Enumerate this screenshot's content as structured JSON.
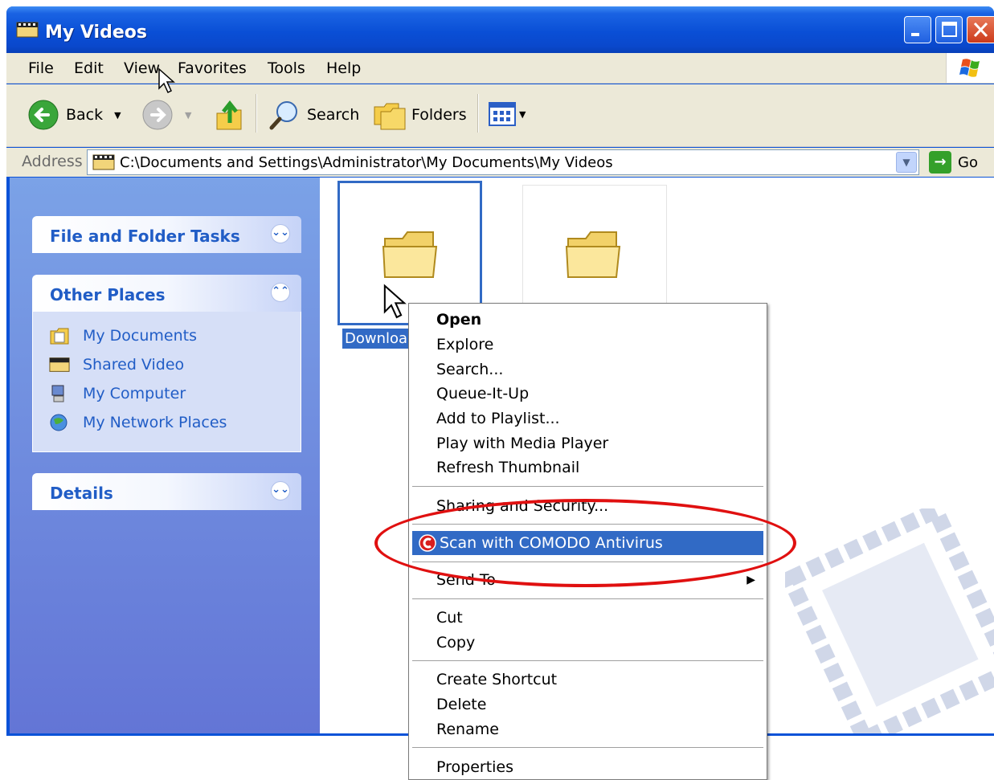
{
  "window": {
    "title": "My Videos"
  },
  "menubar": {
    "items": [
      "File",
      "Edit",
      "View",
      "Favorites",
      "Tools",
      "Help"
    ]
  },
  "toolbar": {
    "back_label": "Back",
    "search_label": "Search",
    "folders_label": "Folders"
  },
  "address": {
    "label": "Address",
    "path": "C:\\Documents and Settings\\Administrator\\My Documents\\My Videos",
    "go_label": "Go"
  },
  "leftpane": {
    "file_tasks": "File and Folder Tasks",
    "other_places": "Other Places",
    "places": [
      "My Documents",
      "Shared Video",
      "My Computer",
      "My Network Places"
    ],
    "details": "Details"
  },
  "content": {
    "selected_folder_label": "Downloac"
  },
  "context_menu": {
    "open": "Open",
    "explore": "Explore",
    "search": "Search...",
    "queue": "Queue-It-Up",
    "add_playlist": "Add to Playlist...",
    "play_media": "Play with Media Player",
    "refresh_thumb": "Refresh Thumbnail",
    "sharing": "Sharing and Security...",
    "scan": "Scan with COMODO Antivirus",
    "send_to": "Send To",
    "cut": "Cut",
    "copy": "Copy",
    "create_shortcut": "Create Shortcut",
    "delete": "Delete",
    "rename": "Rename",
    "properties": "Properties"
  },
  "colors": {
    "selection": "#316ac5",
    "highlight_oval": "#e01010",
    "titlebar": "#0a4fd6"
  }
}
